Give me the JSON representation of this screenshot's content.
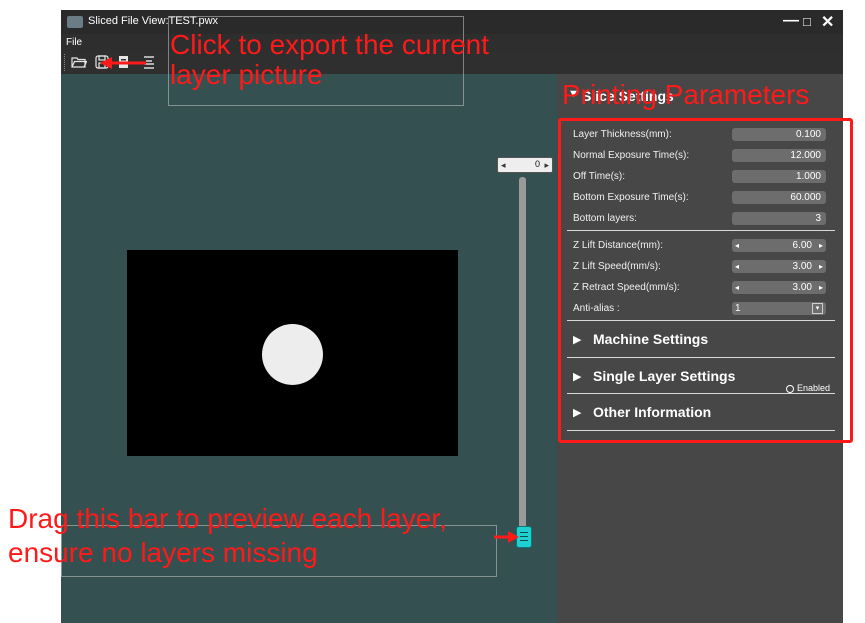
{
  "window": {
    "title": "Sliced File View:TEST.pwx",
    "minimize": "—",
    "maximize": "□",
    "close": "✕"
  },
  "menu": {
    "file": "File"
  },
  "toolbar": {
    "icons": [
      "folder-open-icon",
      "save-icon",
      "export-layer-icon",
      "layers-list-icon"
    ]
  },
  "preview": {
    "layer_value": "0",
    "slider_level": 0
  },
  "panel": {
    "slice_settings": "Slice Settings",
    "params": [
      {
        "label": "Layer Thickness(mm):",
        "value": "0.100"
      },
      {
        "label": "Normal Exposure Time(s):",
        "value": "12.000"
      },
      {
        "label": "Off Time(s):",
        "value": "1.000"
      },
      {
        "label": "Bottom Exposure Time(s):",
        "value": "60.000"
      },
      {
        "label": "Bottom layers:",
        "value": "3"
      }
    ],
    "motion": [
      {
        "label": "Z Lift Distance(mm):",
        "value": "6.00"
      },
      {
        "label": "Z Lift Speed(mm/s):",
        "value": "3.00"
      },
      {
        "label": "Z Retract Speed(mm/s):",
        "value": "3.00"
      }
    ],
    "antialias": {
      "label": "Anti-alias :",
      "value": "1"
    },
    "machine_settings": "Machine Settings",
    "single_layer_settings": "Single Layer Settings",
    "enabled": "Enabled",
    "other_information": "Other Information"
  },
  "annotations": {
    "export": "Click to export the current layer picture",
    "printing": "Printing Parameters",
    "drag": "Drag this bar to preview each layer, ensure no layers missing",
    "color": "#ff1a1a"
  }
}
